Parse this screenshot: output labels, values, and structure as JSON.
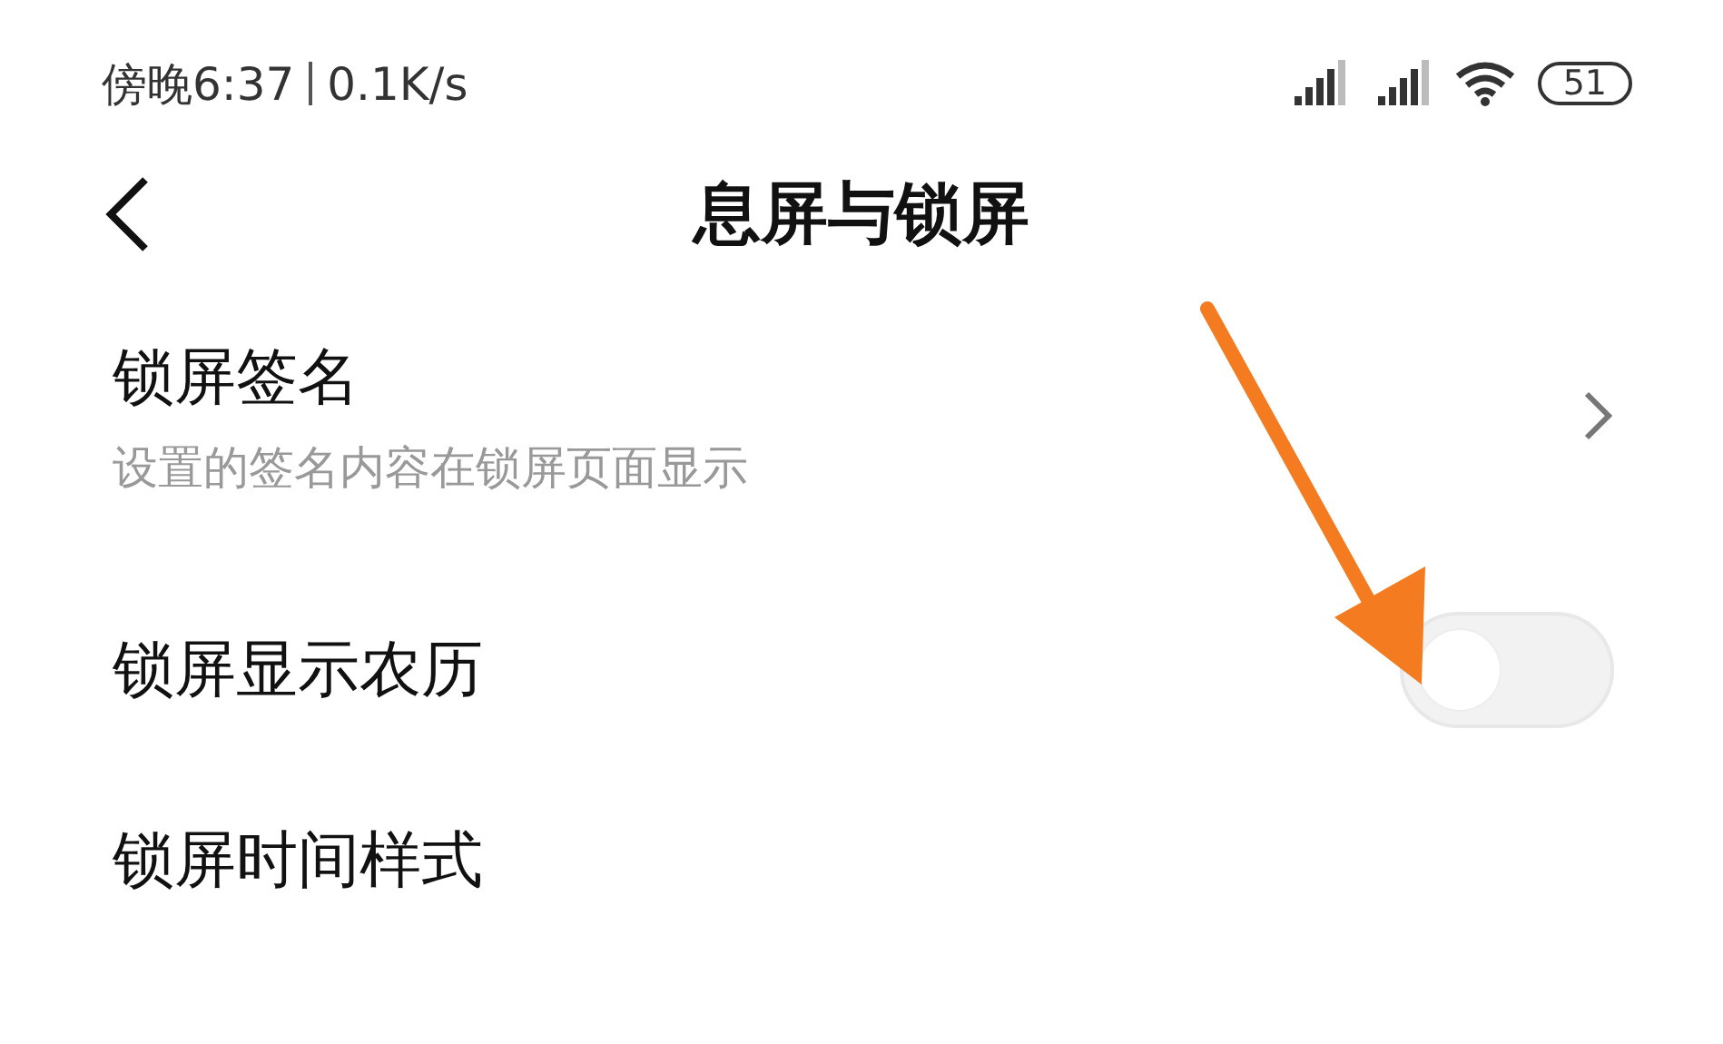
{
  "status_bar": {
    "time": "傍晚6:37",
    "speed": "0.1K/s",
    "battery": "51"
  },
  "header": {
    "title": "息屏与锁屏"
  },
  "items": [
    {
      "kind": "link",
      "title": "锁屏签名",
      "subtitle": "设置的签名内容在锁屏页面显示"
    },
    {
      "kind": "toggle",
      "title": "锁屏显示农历",
      "on": false
    },
    {
      "kind": "plain",
      "title": "锁屏时间样式"
    }
  ]
}
